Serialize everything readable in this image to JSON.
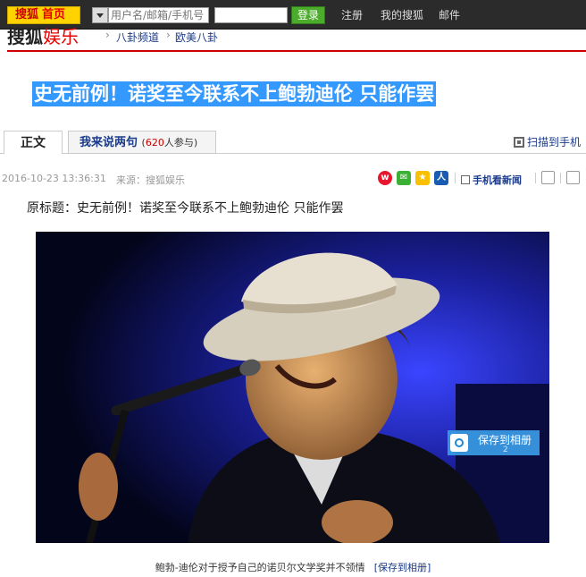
{
  "topbar": {
    "brand_part1": "搜狐",
    "brand_part2": "首页",
    "username_placeholder": "用户名/邮箱/手机号",
    "login_label": "登录",
    "register_label": "注册",
    "my_sohu_label": "我的搜狐",
    "mail_label": "邮件"
  },
  "channel": {
    "logo_part1": "搜狐",
    "logo_part2": "娱乐",
    "breadcrumb": [
      "八卦频道",
      "欧美八卦"
    ],
    "breadcrumb_sep": "›"
  },
  "article": {
    "title": "史无前例！诺奖至今联系不上鲍勃迪伦 只能作罢",
    "tabs": {
      "main": "正文",
      "comment": "我来说两句",
      "comment_count": "620",
      "comment_suffix": "人参与"
    },
    "scan_label": "扫描到手机",
    "datetime": "2016-10-23 13:36:31",
    "source": "来源：搜狐娱乐",
    "mobile_label": "手机看新闻",
    "original_title": "原标题：史无前例！诺奖至今联系不上鲍勃迪伦 只能作罢",
    "image": {
      "save_label": "保存到相册",
      "save_count": "2"
    },
    "caption": "鲍勃-迪伦对于授予自己的诺贝尔文学奖并不领情",
    "caption_link": "[保存到相册]"
  },
  "colors": {
    "topbar_bg": "#2b2b2b",
    "brand_yellow": "#ffd200",
    "login_green": "#4bab2b",
    "accent_red": "#cc0000",
    "title_highlight": "#3399ff",
    "link_blue": "#1a3a8a"
  },
  "icons": [
    "dropdown-arrow-icon",
    "scan-qr-icon",
    "weibo-icon",
    "wechat-icon",
    "qzone-icon",
    "renren-icon",
    "download-icon",
    "font-size-icon",
    "print-icon",
    "save-album-icon"
  ]
}
